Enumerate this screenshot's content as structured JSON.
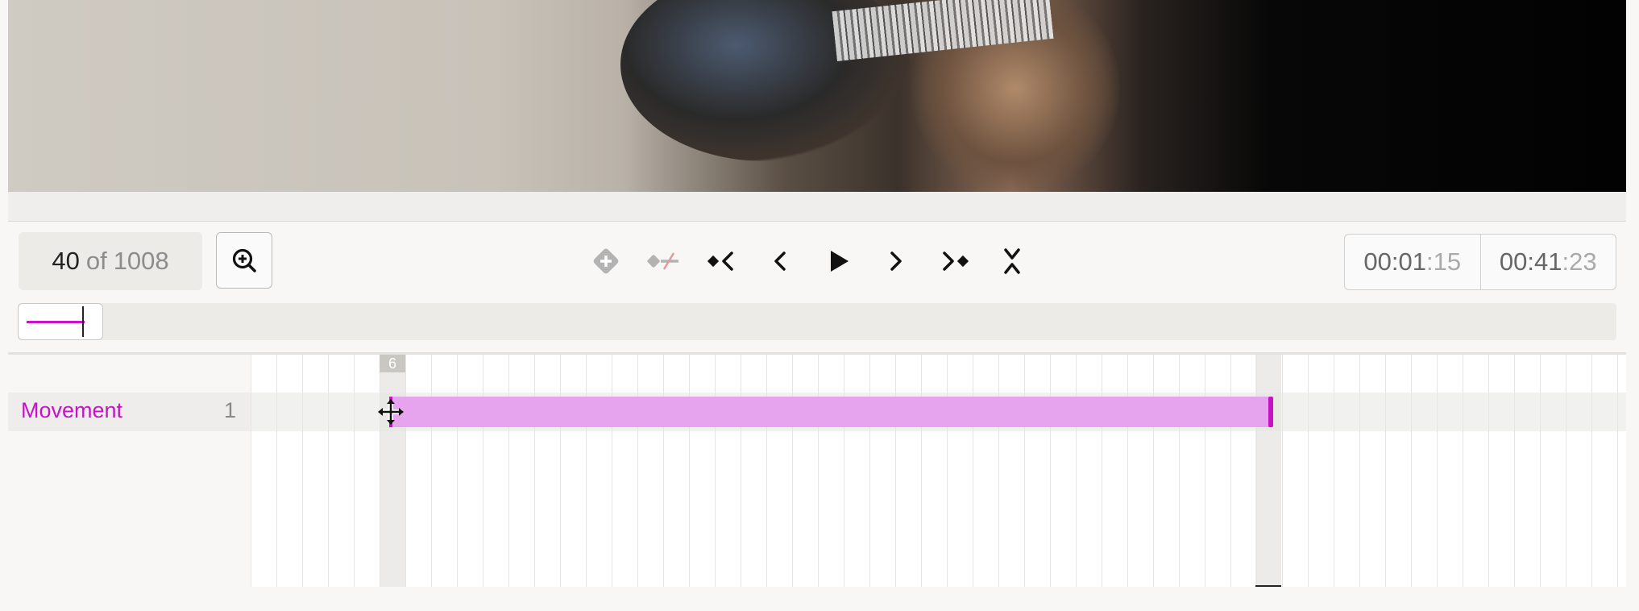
{
  "frame_counter": {
    "current": "40",
    "of": "of",
    "total": "1008"
  },
  "controls": [
    {
      "name": "add-keyframe-icon"
    },
    {
      "name": "remove-keyframe-icon"
    },
    {
      "name": "prev-keyframe-icon"
    },
    {
      "name": "prev-frame-icon"
    },
    {
      "name": "play-icon"
    },
    {
      "name": "next-frame-icon"
    },
    {
      "name": "next-keyframe-icon"
    },
    {
      "name": "collapse-icon"
    }
  ],
  "time": {
    "current": {
      "hms": "00:01",
      "frames": ":15"
    },
    "total": {
      "hms": "00:41",
      "frames": ":23"
    }
  },
  "timeline": {
    "keyframe_badge": "6",
    "track": {
      "label": "Movement",
      "count": "1"
    }
  },
  "colors": {
    "accent": "#c414c4",
    "segment": "#e6a3ee"
  }
}
